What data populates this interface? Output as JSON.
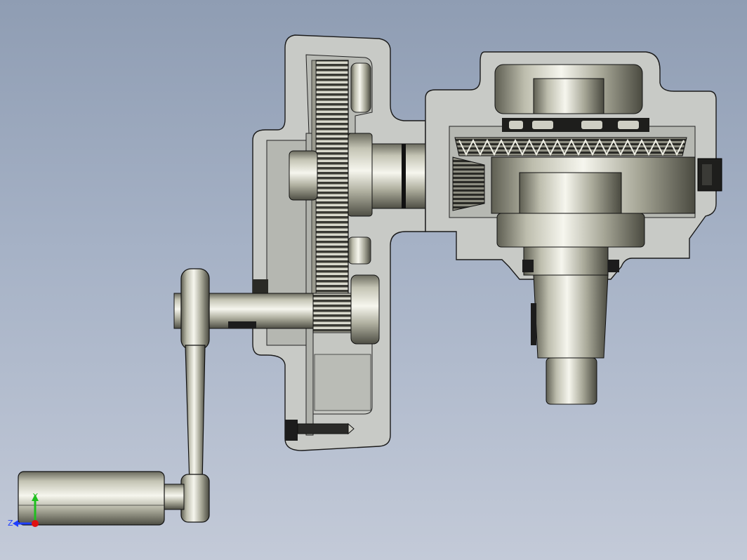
{
  "scene": {
    "background_top": "#8f9db3",
    "background_bottom": "#c3cad8",
    "section_fill": "#c9cbc8",
    "section_edge": "#1a1a1a",
    "metal_light": "#f2f2ea",
    "metal_mid": "#b8b8a8",
    "metal_dark": "#4a4a40"
  },
  "triad": {
    "y_label": "Y",
    "z_label": "Z",
    "y_color": "#1fbf1f",
    "z_color": "#1f3fff",
    "x_color": "#e01010"
  }
}
